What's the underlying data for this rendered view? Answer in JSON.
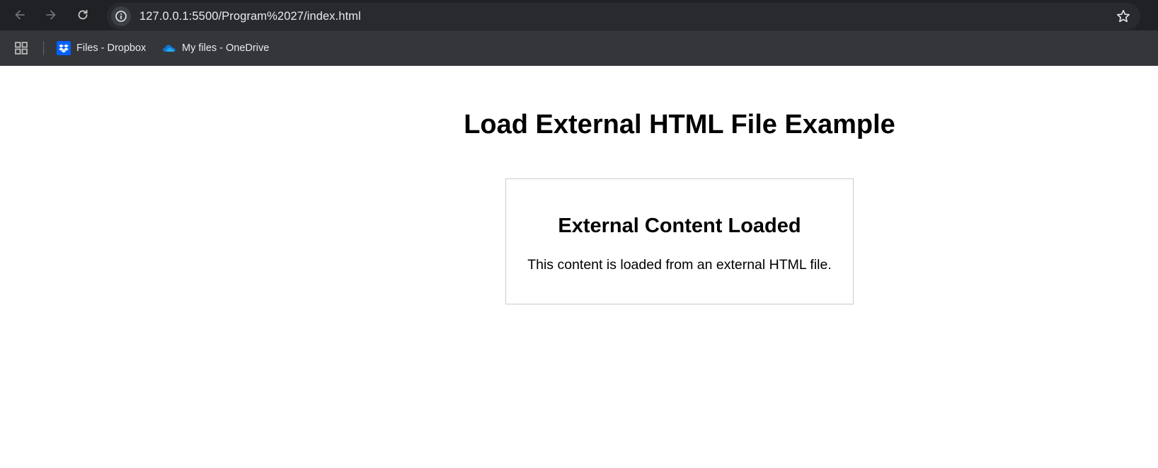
{
  "browser": {
    "url": "127.0.0.1:5500/Program%2027/index.html",
    "icons": {
      "back": "arrow-left-icon",
      "forward": "arrow-right-icon",
      "reload": "reload-icon",
      "site_info": "info-icon",
      "bookmark_star": "star-icon",
      "apps": "apps-grid-icon"
    },
    "bookmarks": [
      {
        "label": "Files - Dropbox",
        "icon": "dropbox-icon"
      },
      {
        "label": "My files - OneDrive",
        "icon": "onedrive-icon"
      }
    ],
    "colors": {
      "toolbar_bg": "#202124",
      "omnibox_bg": "#282a2d",
      "bookmarks_bar_bg": "#35363a",
      "text": "#e8eaed",
      "dropbox_blue": "#0061fe",
      "onedrive_blue": "#0f78d4"
    }
  },
  "page": {
    "title": "Load External HTML File Example",
    "external": {
      "heading": "External Content Loaded",
      "text": "This content is loaded from an external HTML file."
    },
    "colors": {
      "background": "#ffffff",
      "text": "#000000",
      "box_border": "#cccccc"
    }
  }
}
